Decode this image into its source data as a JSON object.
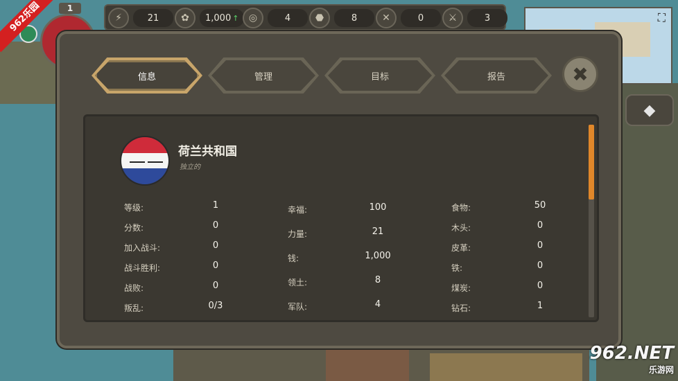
{
  "watermark": {
    "top_left": "962乐园",
    "bottom_right": "962.NET",
    "bottom_right_sub": "乐游网"
  },
  "player": {
    "level": "1"
  },
  "resources": [
    {
      "icon": "lightning-icon",
      "glyph": "⚡",
      "value": "21"
    },
    {
      "icon": "coins-icon",
      "glyph": "✿",
      "value": "1,000",
      "trend": "↑"
    },
    {
      "icon": "shield-icon",
      "glyph": "◎",
      "value": "4"
    },
    {
      "icon": "map-territory-icon",
      "glyph": "⬣",
      "value": "8"
    },
    {
      "icon": "crossed-swords-icon",
      "glyph": "✕",
      "value": "0"
    },
    {
      "icon": "sword-icon",
      "glyph": "⚔",
      "value": "3"
    }
  ],
  "minimap": {
    "expand_icon": "⛶"
  },
  "diamond_button": {
    "glyph": "◆"
  },
  "tabs": [
    {
      "label": "信息",
      "active": true
    },
    {
      "label": "管理",
      "active": false
    },
    {
      "label": "目标",
      "active": false
    },
    {
      "label": "报告",
      "active": false
    }
  ],
  "close": {
    "glyph": "✖"
  },
  "country": {
    "name": "荷兰共和国",
    "status": "独立的"
  },
  "stats": {
    "col1": [
      {
        "label": "等级:",
        "value": "1"
      },
      {
        "label": "分数:",
        "value": "0"
      },
      {
        "label": "加入战斗:",
        "value": "0"
      },
      {
        "label": "战斗胜利:",
        "value": "0"
      },
      {
        "label": "战败:",
        "value": "0"
      },
      {
        "label": "叛乱:",
        "value": "0/3"
      }
    ],
    "col2": [
      {
        "label": "幸福:",
        "value": "100"
      },
      {
        "label": "力量:",
        "value": "21"
      },
      {
        "label": "钱:",
        "value": "1,000"
      },
      {
        "label": "领土:",
        "value": "8"
      },
      {
        "label": "军队:",
        "value": "4"
      }
    ],
    "col3": [
      {
        "label": "食物:",
        "value": "50"
      },
      {
        "label": "木头:",
        "value": "0"
      },
      {
        "label": "皮革:",
        "value": "0"
      },
      {
        "label": "铁:",
        "value": "0"
      },
      {
        "label": "煤炭:",
        "value": "0"
      },
      {
        "label": "钻石:",
        "value": "1"
      }
    ]
  },
  "colors": {
    "accent": "#e0872a",
    "tab_active": "#c8a56a",
    "panel": "#4e4a41"
  }
}
